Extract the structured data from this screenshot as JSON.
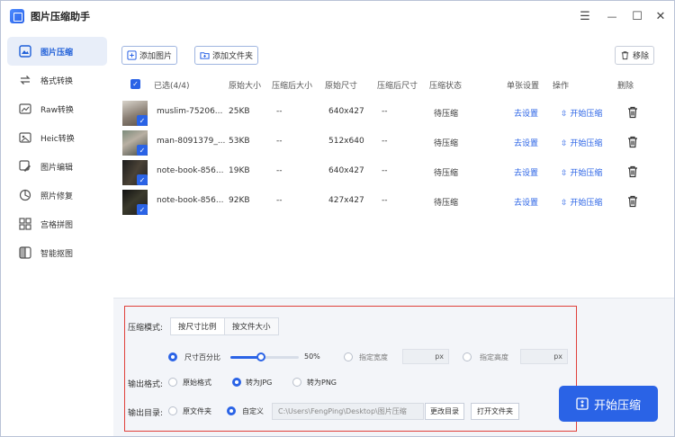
{
  "window": {
    "title": "图片压缩助手",
    "controls": {
      "menu": "☰",
      "minimize": "—",
      "maximize": "☐",
      "close": "✕"
    }
  },
  "sidebar": {
    "items": [
      {
        "label": "图片压缩",
        "icon": "image-compress-icon",
        "active": true
      },
      {
        "label": "格式转换",
        "icon": "format-convert-icon",
        "active": false
      },
      {
        "label": "Raw转换",
        "icon": "raw-convert-icon",
        "active": false
      },
      {
        "label": "Heic转换",
        "icon": "heic-convert-icon",
        "active": false
      },
      {
        "label": "图片编辑",
        "icon": "image-edit-icon",
        "active": false
      },
      {
        "label": "照片修复",
        "icon": "photo-repair-icon",
        "active": false
      },
      {
        "label": "宫格拼图",
        "icon": "grid-collage-icon",
        "active": false
      },
      {
        "label": "智能抠图",
        "icon": "smart-cutout-icon",
        "active": false
      }
    ]
  },
  "toolbar": {
    "add_image": "添加图片",
    "add_folder": "添加文件夹",
    "remove": "移除"
  },
  "table": {
    "headers": {
      "selected": "已选(4/4)",
      "original_size": "原始大小",
      "compressed_size": "压缩后大小",
      "original_dim": "原始尺寸",
      "compressed_dim": "压缩后尺寸",
      "status": "压缩状态",
      "single_setting": "单张设置",
      "action": "操作",
      "delete": "删除"
    },
    "rows": [
      {
        "name": "muslim-75206...",
        "orig_size": "25KB",
        "comp_size": "--",
        "orig_dim": "640x427",
        "comp_dim": "--",
        "status": "待压缩",
        "setting": "去设置",
        "action": "开始压缩"
      },
      {
        "name": "man-8091379_...",
        "orig_size": "53KB",
        "comp_size": "--",
        "orig_dim": "512x640",
        "comp_dim": "--",
        "status": "待压缩",
        "setting": "去设置",
        "action": "开始压缩"
      },
      {
        "name": "note-book-856...",
        "orig_size": "19KB",
        "comp_size": "--",
        "orig_dim": "640x427",
        "comp_dim": "--",
        "status": "待压缩",
        "setting": "去设置",
        "action": "开始压缩"
      },
      {
        "name": "note-book-856...",
        "orig_size": "92KB",
        "comp_size": "--",
        "orig_dim": "427x427",
        "comp_dim": "--",
        "status": "待压缩",
        "setting": "去设置",
        "action": "开始压缩"
      }
    ]
  },
  "settings": {
    "mode_label": "压缩模式:",
    "mode_tabs": [
      "按尺寸比例",
      "按文件大小"
    ],
    "size_percent_label": "尺寸百分比",
    "size_percent_value": 50,
    "size_percent_text": "50%",
    "width_label": "指定宽度",
    "height_label": "指定高度",
    "unit": "px",
    "format_label": "输出格式:",
    "format_options": [
      "原始格式",
      "转为JPG",
      "转为PNG"
    ],
    "format_selected": "转为JPG",
    "dir_label": "输出目录:",
    "dir_options": [
      "原文件夹",
      "自定义"
    ],
    "dir_selected": "自定义",
    "dir_path": "C:\\Users\\FengPing\\Desktop\\图片压缩",
    "change_dir": "更改目录",
    "open_folder": "打开文件夹"
  },
  "start_button": "开始压缩",
  "colors": {
    "accent": "#2a63e6",
    "highlight_frame": "#e0403a"
  }
}
